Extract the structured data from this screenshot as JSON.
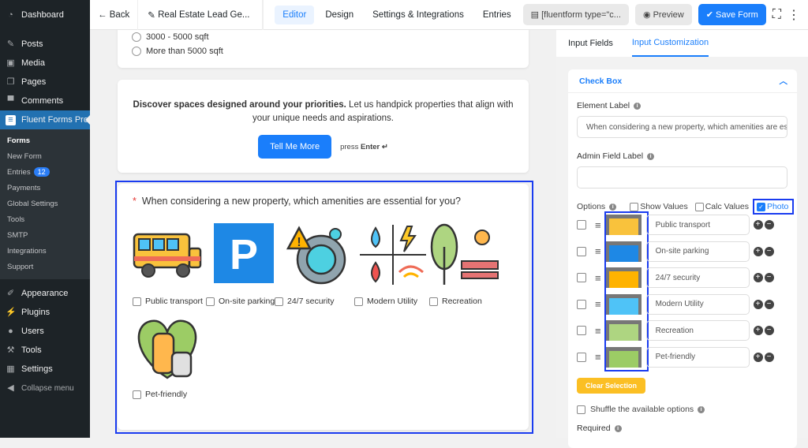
{
  "sidebar": {
    "items": [
      {
        "label": "Dashboard",
        "icon": "dashboard-icon"
      },
      {
        "label": "Posts",
        "icon": "pin-icon"
      },
      {
        "label": "Media",
        "icon": "media-icon"
      },
      {
        "label": "Pages",
        "icon": "pages-icon"
      },
      {
        "label": "Comments",
        "icon": "comment-icon"
      },
      {
        "label": "Fluent Forms Pro",
        "icon": "fluent-forms-icon"
      }
    ],
    "submenu": [
      "Forms",
      "New Form",
      "Entries",
      "Payments",
      "Global Settings",
      "Tools",
      "SMTP",
      "Integrations",
      "Support"
    ],
    "entries_badge": "12",
    "bottom": [
      {
        "label": "Appearance"
      },
      {
        "label": "Plugins"
      },
      {
        "label": "Users"
      },
      {
        "label": "Tools"
      },
      {
        "label": "Settings"
      },
      {
        "label": "Collapse menu"
      }
    ]
  },
  "topbar": {
    "back": "Back",
    "title": "Real Estate Lead Ge...",
    "tabs": [
      "Editor",
      "Design",
      "Settings & Integrations",
      "Entries"
    ],
    "active_tab": "Editor",
    "shortcode": "[fluentform type=\"c...",
    "preview": "Preview",
    "save": "Save Form"
  },
  "form": {
    "radio_options": [
      "3000 - 5000 sqft",
      "More than 5000 sqft"
    ],
    "intro_bold": "Discover spaces designed around your priorities.",
    "intro_text": " Let us handpick properties that align with your unique needs and aspirations.",
    "cta": "Tell Me More",
    "press": "press",
    "enter": "Enter ↵",
    "question": "When considering a new property, which amenities are essential for you?",
    "required_mark": "*",
    "options": [
      "Public transport",
      "On-site parking",
      "24/7 security",
      "Modern Utility",
      "Recreation",
      "Pet-friendly"
    ]
  },
  "panel": {
    "tabs": [
      "Input Fields",
      "Input Customization"
    ],
    "active_tab": "Input Customization",
    "section": "Check Box",
    "element_label": "Element Label",
    "element_value": "When considering a new property, which amenities are essential for you?",
    "admin_label": "Admin Field Label",
    "admin_value": "",
    "options_label": "Options",
    "show_values": "Show Values",
    "calc_values": "Calc Values",
    "photo": "Photo",
    "photo_checked": true,
    "clear": "Clear Selection",
    "shuffle": "Shuffle the available options",
    "required": "Required"
  },
  "colors": {
    "accent": "#1a7efb",
    "sidebar": "#1d2327",
    "highlight": "#1a3cf0",
    "clear_btn": "#fbbf24"
  }
}
